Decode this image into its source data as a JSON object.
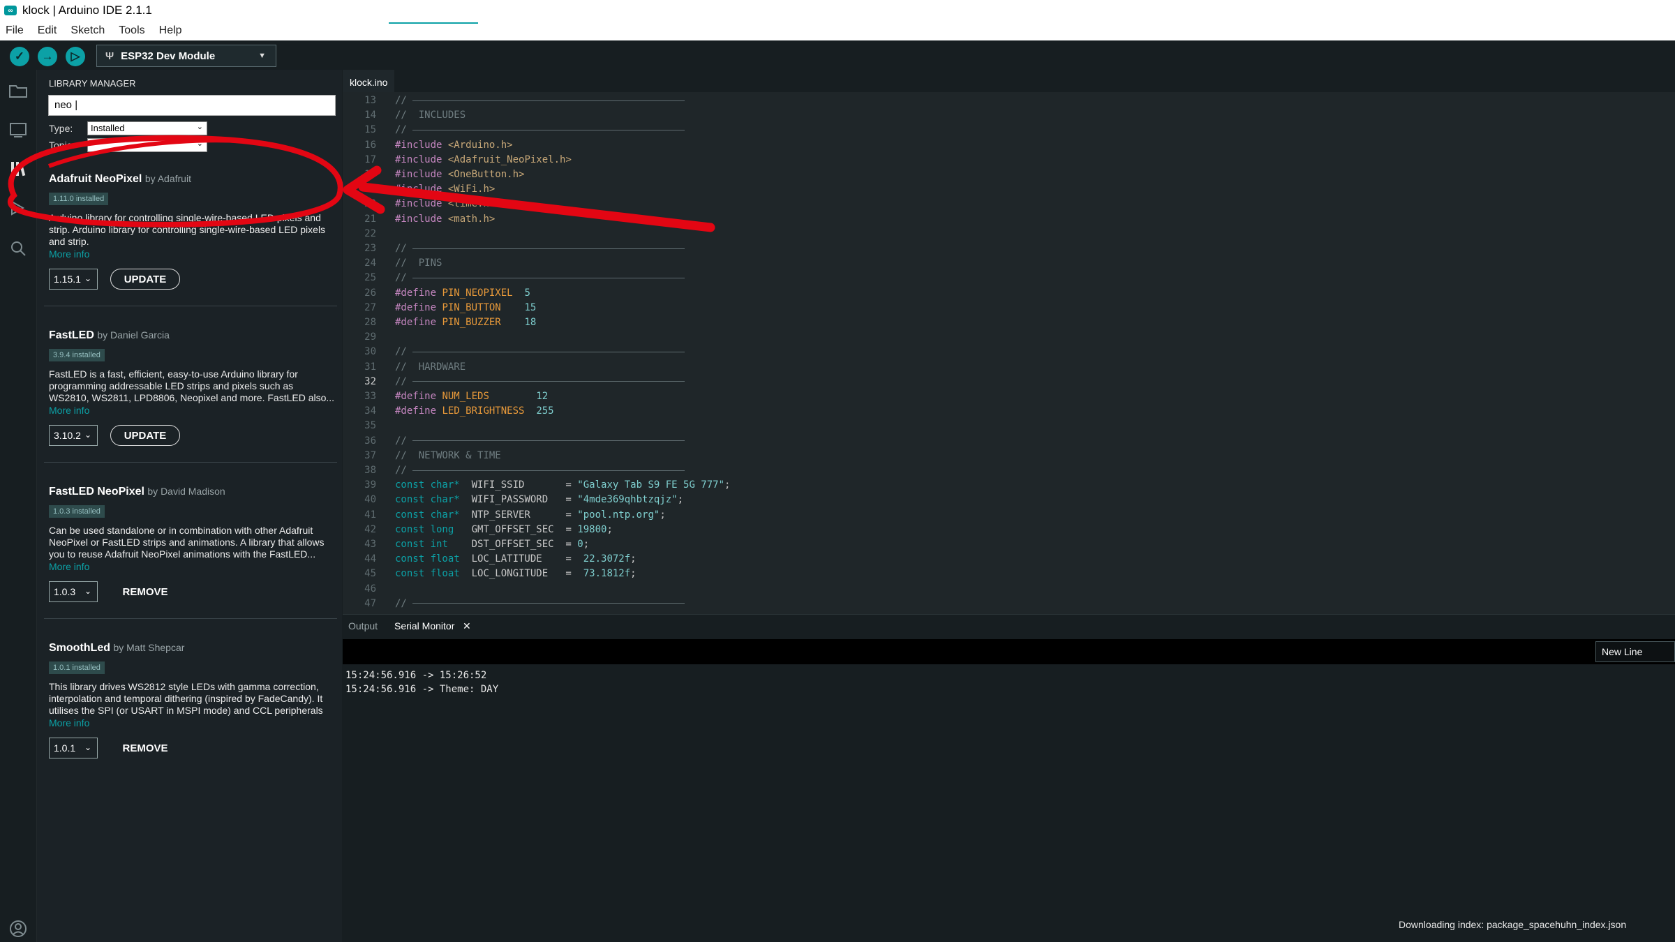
{
  "window": {
    "title": "klock | Arduino IDE 2.1.1",
    "logo_text": "∞"
  },
  "menu": [
    "File",
    "Edit",
    "Sketch",
    "Tools",
    "Help"
  ],
  "toolbar": {
    "verify_icon": "✓",
    "upload_icon": "→",
    "debug_icon": "▷",
    "board_icon": "Ψ",
    "board": "ESP32 Dev Module",
    "board_arrow": "▼"
  },
  "sidebar_icons": [
    "folder-icon",
    "board-manager-icon",
    "library-manager-icon",
    "debug-icon",
    "search-icon",
    "account-icon"
  ],
  "library_manager": {
    "title": "LIBRARY MANAGER",
    "search_value": "neo |",
    "type_label": "Type:",
    "type_value": "Installed",
    "topic_label": "Topic:",
    "topic_value": "",
    "libraries": [
      {
        "name": "Adafruit NeoPixel",
        "author": "by Adafruit",
        "installed": "1.11.0 installed",
        "description": "Arduino library for controlling single-wire-based LED pixels and strip. Arduino library for controlling single-wire-based LED pixels and strip.",
        "more": "More info",
        "version": "1.15.1",
        "action": "UPDATE"
      },
      {
        "name": "FastLED",
        "author": "by Daniel Garcia",
        "installed": "3.9.4 installed",
        "description": "FastLED is a fast, efficient, easy-to-use Arduino library for programming addressable LED strips and pixels such as WS2810, WS2811, LPD8806, Neopixel and more. FastLED also...",
        "more": "More info",
        "version": "3.10.2",
        "action": "UPDATE"
      },
      {
        "name": "FastLED NeoPixel",
        "author": "by David Madison",
        "installed": "1.0.3 installed",
        "description": "Can be used standalone or in combination with other Adafruit NeoPixel or FastLED strips and animations. A library that allows you to reuse Adafruit NeoPixel animations with the FastLED...",
        "more": "More info",
        "version": "1.0.3",
        "action": "REMOVE"
      },
      {
        "name": "SmoothLed",
        "author": "by Matt Shepcar",
        "installed": "1.0.1 installed",
        "description": "This library drives WS2812 style LEDs with gamma correction, interpolation and temporal dithering (inspired by FadeCandy). It utilises the SPI (or USART in MSPI mode) and CCL peripherals o...",
        "more": "More info",
        "version": "1.0.1",
        "action": "REMOVE"
      }
    ]
  },
  "editor": {
    "tab": "klock.ino",
    "current_line": "32",
    "lines": [
      {
        "n": "13",
        "t": "//"
      },
      {
        "n": "14",
        "t": "//  INCLUDES"
      },
      {
        "n": "15",
        "t": "//"
      },
      {
        "n": "16",
        "t": "#include <Arduino.h>"
      },
      {
        "n": "17",
        "t": "#include <Adafruit_NeoPixel.h>"
      },
      {
        "n": "18",
        "t": "#include <OneButton.h>"
      },
      {
        "n": "19",
        "t": "#include <WiFi.h>"
      },
      {
        "n": "20",
        "t": "#include <time.h>"
      },
      {
        "n": "21",
        "t": "#include <math.h>"
      },
      {
        "n": "22",
        "t": ""
      },
      {
        "n": "23",
        "t": "//"
      },
      {
        "n": "24",
        "t": "//  PINS"
      },
      {
        "n": "25",
        "t": "//"
      },
      {
        "n": "26",
        "t": "#define PIN_NEOPIXEL  5"
      },
      {
        "n": "27",
        "t": "#define PIN_BUTTON    15"
      },
      {
        "n": "28",
        "t": "#define PIN_BUZZER    18"
      },
      {
        "n": "29",
        "t": ""
      },
      {
        "n": "30",
        "t": "//"
      },
      {
        "n": "31",
        "t": "//  HARDWARE"
      },
      {
        "n": "32",
        "t": "//"
      },
      {
        "n": "33",
        "t": "#define NUM_LEDS        12"
      },
      {
        "n": "34",
        "t": "#define LED_BRIGHTNESS  255"
      },
      {
        "n": "35",
        "t": ""
      },
      {
        "n": "36",
        "t": "//"
      },
      {
        "n": "37",
        "t": "//  NETWORK & TIME"
      },
      {
        "n": "38",
        "t": "//"
      },
      {
        "n": "39",
        "t": "const char*  WIFI_SSID       = \"Galaxy Tab S9 FE 5G 777\";"
      },
      {
        "n": "40",
        "t": "const char*  WIFI_PASSWORD   = \"4mde369qhbtzqjz\";"
      },
      {
        "n": "41",
        "t": "const char*  NTP_SERVER      = \"pool.ntp.org\";"
      },
      {
        "n": "42",
        "t": "const long   GMT_OFFSET_SEC  = 19800;"
      },
      {
        "n": "43",
        "t": "const int    DST_OFFSET_SEC  = 0;"
      },
      {
        "n": "44",
        "t": "const float  LOC_LATITUDE    =  22.3072f;"
      },
      {
        "n": "45",
        "t": "const float  LOC_LONGITUDE   =  73.1812f;"
      },
      {
        "n": "46",
        "t": ""
      },
      {
        "n": "47",
        "t": "//"
      }
    ]
  },
  "bottom_panel": {
    "tabs": [
      "Output",
      "Serial Monitor"
    ],
    "close_icon": "✕",
    "newline_option": "New Line",
    "serial_lines": [
      "15:24:56.916 -> 15:26:52",
      "15:24:56.916 -> Theme: DAY"
    ]
  },
  "status": {
    "message": "Downloading index: package_spacehuhn_index.json"
  },
  "colors": {
    "accent": "#0ca1a6",
    "annotation": "#e30613",
    "background": "#171e21"
  }
}
